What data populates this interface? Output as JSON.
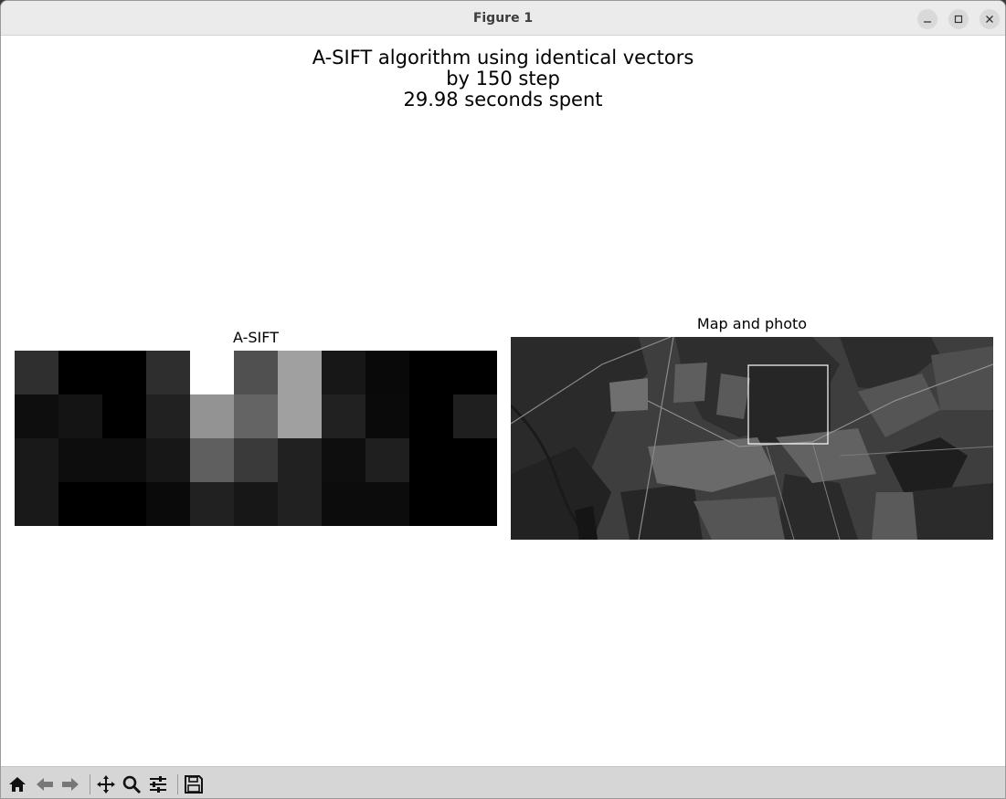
{
  "window": {
    "title": "Figure 1",
    "controls": [
      "minimize-icon",
      "maximize-icon",
      "close-icon"
    ]
  },
  "figure": {
    "suptitle_lines": [
      "A-SIFT algorithm using identical vectors",
      "by 150 step",
      "29.98 seconds spent"
    ],
    "left_axes_title": "A-SIFT",
    "right_axes_title": "Map and photo"
  },
  "chart_data": {
    "type": "heatmap",
    "title": "A-SIFT",
    "rows": 4,
    "cols": 11,
    "colormap": "gray",
    "values": [
      [
        47,
        0,
        0,
        46,
        255,
        80,
        160,
        23,
        9,
        0,
        0
      ],
      [
        14,
        20,
        0,
        33,
        147,
        100,
        160,
        33,
        10,
        0,
        31
      ],
      [
        25,
        13,
        13,
        23,
        95,
        58,
        33,
        14,
        31,
        0,
        0
      ],
      [
        25,
        0,
        0,
        10,
        33,
        23,
        33,
        12,
        12,
        0,
        0
      ]
    ]
  },
  "photo": {
    "description_icon": "satellite-map-image",
    "box_color": "#ffffff"
  },
  "toolbar": {
    "buttons": [
      "home-icon",
      "back-icon",
      "forward-icon",
      "pan-icon",
      "zoom-icon",
      "configure-subplots-icon",
      "save-icon"
    ]
  }
}
